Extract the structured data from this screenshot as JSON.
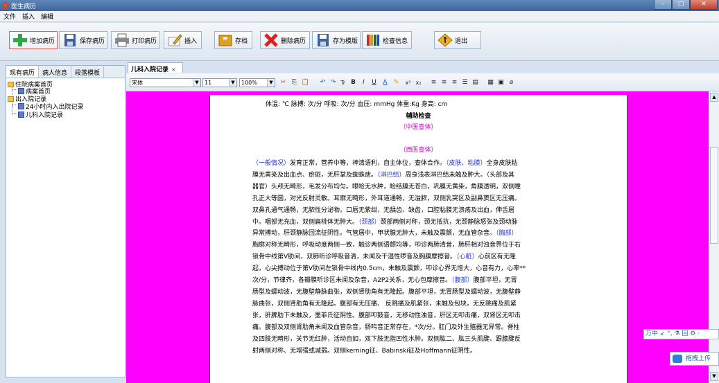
{
  "window": {
    "title": "医生病历"
  },
  "menu": [
    "文件",
    "插入",
    "编辑"
  ],
  "toolbar": {
    "add_record": "增加病历",
    "save_record": "保存病历",
    "print_record": "打印病历",
    "insert": "插入",
    "archive": "存档",
    "delete_record": "删除病历",
    "save_template": "存为模版",
    "check_info": "检查信息",
    "exit": "退出"
  },
  "left_tabs": [
    "现有病历",
    "病人信息",
    "段落模板"
  ],
  "tree": {
    "root1": "住院病案首页",
    "root1_child": "病案首页",
    "root2": "出入院记录",
    "root2_child1": "24小时内入出院记录",
    "root2_child2": "儿科入院记录"
  },
  "doc_tab": {
    "label": "儿科入院记录",
    "close": "×"
  },
  "format": {
    "font": "宋体",
    "size": "11",
    "zoom": "100%"
  },
  "document": {
    "vitals": "体温: ℃       脉搏: 次/分      呼吸: 次/分       血压: mmHg    体重:Kg    身高: cm",
    "aux_exam": "辅助检查",
    "tcm_exam": "（中医查体）",
    "wm_exam": "（西医查体）",
    "paragraphs": [
      "（一般情况）发育正常，营养中等，神清语利，自主体位，查体合作。（皮肤、粘膜）全身皮肤粘",
      "膜无黄染及出血点、瘀斑，无肝掌及蜘蛛痣。（淋巴结）周身浅表淋巴结未触及肿大。（头部及其",
      "器官）头颅无畸形，毛发分布均匀。眼睑无水肿，睑结膜无苍白，巩膜无黄染，角膜透明，双侧瞳",
      "孔正大等圆，对光反射灵敏。耳廓无畸形，外耳道通畅，无溢脓，双侧乳突区及副鼻窦区无压痛。",
      "双鼻孔通气通畅，无脓性分泌物。口唇无紫绀，无龋齿、缺齿，口腔粘膜无溃疡及出血，伸舌居",
      "中。咽部无充血，双侧扁桃体无肿大。（颈部）颈部两侧对称，颈无抵抗，无颈静脉怒张及颈动脉",
      "异常搏动，肝颈静脉回流征阴性。气管居中，甲状腺无肿大，未触及震颤，无血管杂音。（胸部）",
      "胸廓对称无畸形，呼吸动度两侧一致，触诊两侧语颤均等，叩诊两肺清音，肺肝相对浊音界位于右",
      "锁骨中线第Ⅴ肋间，双肺听诊呼吸音清，未闻及干湿性啰音及胸膜摩擦音。（心脏）心前区有无隆",
      "起，心尖搏动位于第Ⅴ肋间左锁骨中线内0.5cm，未触及震颤，叩诊心界无增大，心音有力，心率**",
      "次/分，节律齐，各瓣膜听诊区未闻及杂音，A2P2关系，无心包摩擦音。（腹部）腹部平坦，无胃",
      "肠型及蠕动波，无腹壁静脉曲张，双侧肾肋角有无隆起。腹部平坦，无胃肠型及蠕动波，无腹壁静",
      "脉曲张，双侧肾肋角有无隆起。腹部有无压痛、 反跳痛及肌紧张，未触及包块，无反跳痛及肌紧",
      "张，肝脾肋下未触及，墨菲氏征阴性。腹部叩鼓音，无移动性浊音，肝区无叩击痛，双肾区无叩击",
      "痛。腹部及双侧肾肋角未闻及血管杂音，肠鸣音正常存在，*次/分。肛门及外生殖器无异常。脊柱",
      "及四肢无畸形，关节无红肿，活动自如，双下肢无指凹性水肿。双侧肱二、肱三头肌腱、跟膝腱反",
      "射两侧对称、无增强或减弱。双侧kerning征、Babinski征及Hoffmann征阴性。"
    ]
  },
  "ime_bar": "万中 ↙ °, ⚗ 回 ⚙ ·",
  "upload": "拖拽上传",
  "colors": {
    "canvas": "#fe00fe",
    "section_label": "#2838d8",
    "exam_heading": "#d000d0"
  }
}
